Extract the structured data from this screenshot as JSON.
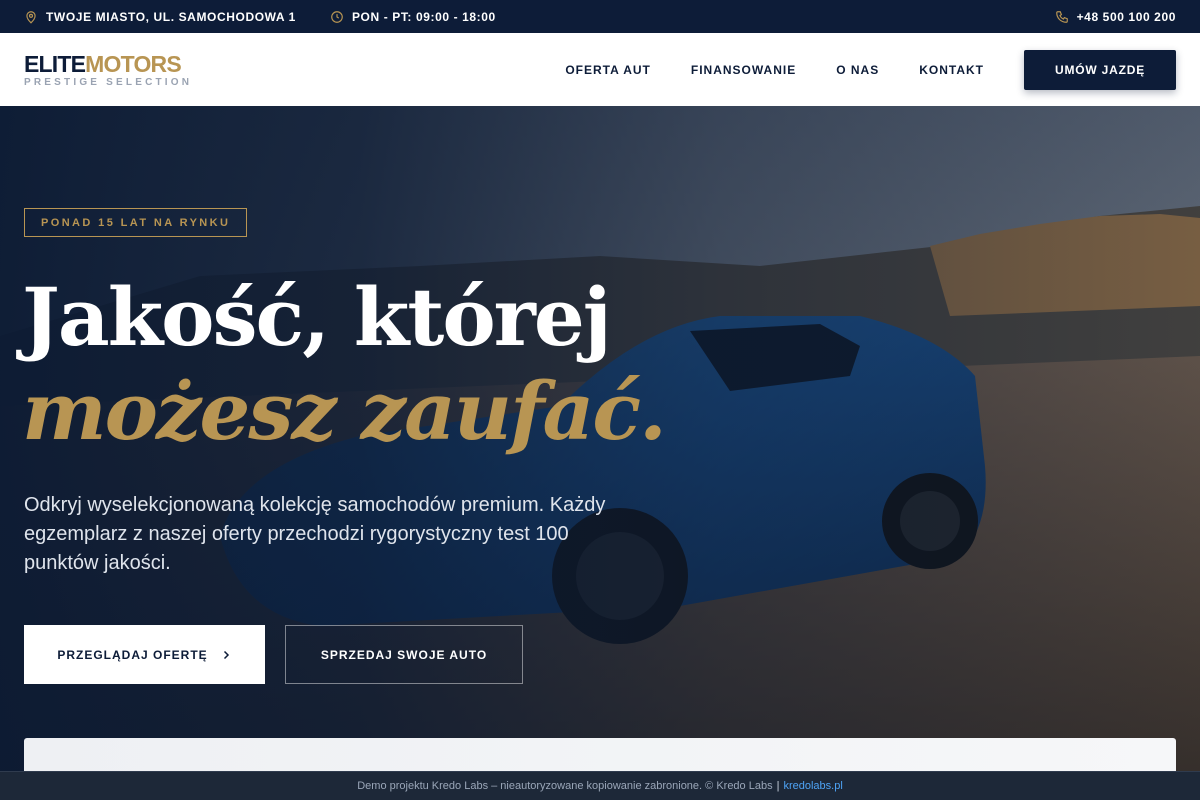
{
  "topbar": {
    "address": "TWOJE MIASTO, UL. SAMOCHODOWA 1",
    "hours": "PON - PT: 09:00 - 18:00",
    "phone": "+48 500 100 200"
  },
  "logo": {
    "elite": "ELITE",
    "motors": "MOTORS",
    "tagline": "PRESTIGE SELECTION"
  },
  "nav": {
    "items": [
      "OFERTA AUT",
      "FINANSOWANIE",
      "O NAS",
      "KONTAKT"
    ],
    "cta": "UMÓW JAZDĘ"
  },
  "hero": {
    "badge": "PONAD 15 LAT NA RYNKU",
    "headline_line1": "Jakość, której",
    "headline_line2": "możesz zaufać.",
    "description": "Odkryj wyselekcjonowaną kolekcję samochodów premium. Każdy egzemplarz z naszej oferty przechodzi rygorystyczny test 100 punktów jakości.",
    "primary_button": "PRZEGLĄDAJ OFERTĘ",
    "secondary_button": "SPRZEDAJ SWOJE AUTO"
  },
  "demo_bar": {
    "text": "Demo projektu Kredo Labs – nieautoryzowane kopiowanie zabronione. © Kredo Labs",
    "separator": "|",
    "link": "kredolabs.pl"
  },
  "colors": {
    "navy": "#0d1c38",
    "gold": "#b89553",
    "link_blue": "#4ea3f5"
  },
  "icons": {
    "address": "map-pin-icon",
    "hours": "clock-icon",
    "phone": "phone-icon",
    "primary_button": "chevron-right-icon"
  }
}
